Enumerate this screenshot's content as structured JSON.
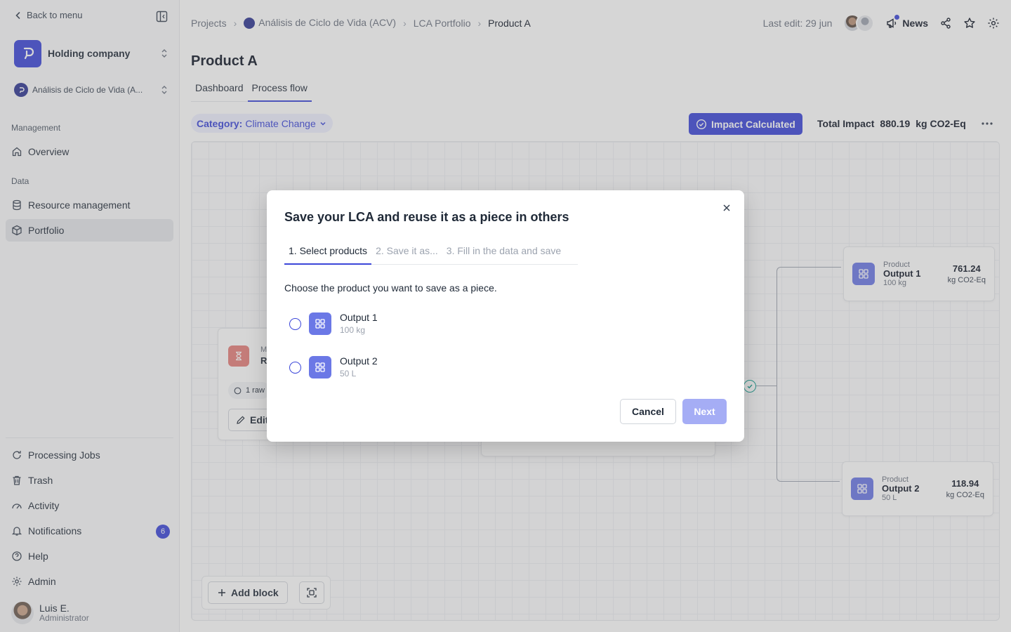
{
  "sidebar": {
    "back_label": "Back to menu",
    "org_name": "Holding company",
    "project_name": "Análisis de Ciclo de Vida (A...",
    "sections": {
      "management": "Management",
      "data": "Data"
    },
    "items": {
      "overview": "Overview",
      "resource_management": "Resource management",
      "portfolio": "Portfolio",
      "processing_jobs": "Processing Jobs",
      "trash": "Trash",
      "activity": "Activity",
      "notifications": "Notifications",
      "help": "Help",
      "admin": "Admin"
    },
    "notifications_count": "6",
    "user": {
      "name": "Luis E.",
      "role": "Administrator"
    }
  },
  "header": {
    "breadcrumbs": [
      "Projects",
      "Análisis de Ciclo de Vida (ACV)",
      "LCA Portfolio",
      "Product A"
    ],
    "last_edit": "Last edit: 29 jun",
    "news_label": "News"
  },
  "page": {
    "title": "Product A",
    "tabs": [
      "Dashboard",
      "Process flow"
    ],
    "category_label": "Category:",
    "category_value": "Climate Change",
    "impact_button": "Impact Calculated",
    "total_label": "Total Impact",
    "total_value": "880.19",
    "total_unit": "kg CO2-Eq"
  },
  "canvas": {
    "products": [
      {
        "kind": "Product",
        "name": "Output 1",
        "quantity": "100 kg",
        "value": "761.24",
        "unit": "kg CO2-Eq"
      },
      {
        "kind": "Product",
        "name": "Output 2",
        "quantity": "50 L",
        "value": "118.94",
        "unit": "kg CO2-Eq"
      }
    ],
    "hidden_node": {
      "kind": "M",
      "name": "R",
      "tag": "1 raw",
      "edit": "Edit"
    },
    "add_block_label": "Add block"
  },
  "modal": {
    "title": "Save your LCA and reuse it as a piece in others",
    "steps": [
      "1. Select products",
      "2. Save it as...",
      "3. Fill in the data and save"
    ],
    "instruction": "Choose the product you want to save as a piece.",
    "options": [
      {
        "name": "Output 1",
        "quantity": "100 kg"
      },
      {
        "name": "Output 2",
        "quantity": "50 L"
      }
    ],
    "cancel_label": "Cancel",
    "next_label": "Next"
  },
  "colors": {
    "accent": "#3b46d9",
    "product_icon": "#6b78e6",
    "next_disabled": "#a5adf5"
  }
}
